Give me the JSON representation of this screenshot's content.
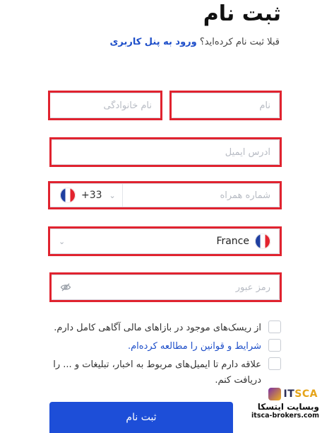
{
  "title": "ثبت نام",
  "already_text": "قبلا ثبت نام کرده‌اید؟",
  "login_link": "ورود به پنل کاربری",
  "form": {
    "first_name_placeholder": "نام",
    "last_name_placeholder": "نام خانوادگی",
    "email_placeholder": "آدرس ایمیل",
    "phone_code": "+33",
    "phone_placeholder": "شماره همراه",
    "country": "France",
    "password_placeholder": "رمز عبور"
  },
  "checkboxes": {
    "risk_prefix": "از ریسک‌های موجود در بازاهای مالی آگاهی کامل دارم.",
    "terms": "شرایط و قوانین را مطالعه کرده‌ام.",
    "newsletter": "علاقه دارم تا ایمیل‌های مربوط به اخبار، تبلیغات و ... را دریافت کنم."
  },
  "submit_label": "ثبت نام",
  "watermark": {
    "logo_main": "IT",
    "logo_accent": "SCA",
    "fa_text": "وبسایت ایتسکا",
    "url": "itsca-brokers.com"
  },
  "colors": {
    "accent": "#1d4ed8",
    "link": "#1d4ec9",
    "highlight": "#e0232f"
  },
  "icons": {
    "flag": "france-flag-icon",
    "chevron": "chevron-down-icon",
    "eye": "eye-off-icon"
  }
}
